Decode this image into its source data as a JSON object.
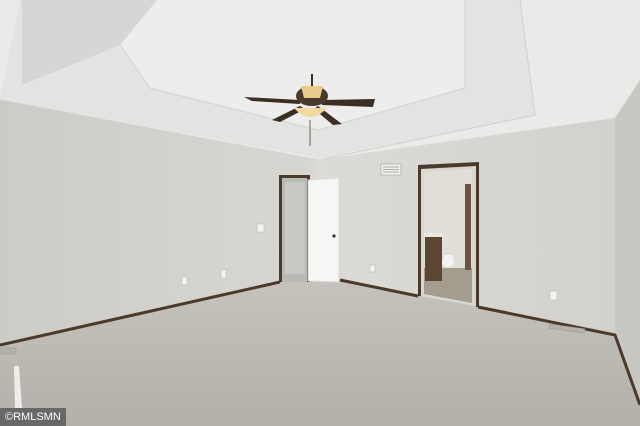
{
  "photo": {
    "watermark": "©RMLSMN",
    "colors": {
      "ceiling": "#ececea",
      "wall": "#d7d5d0",
      "carpet": "#bdb9b3",
      "trim": "#4a3a2c",
      "door": "#f7f7f5"
    }
  }
}
